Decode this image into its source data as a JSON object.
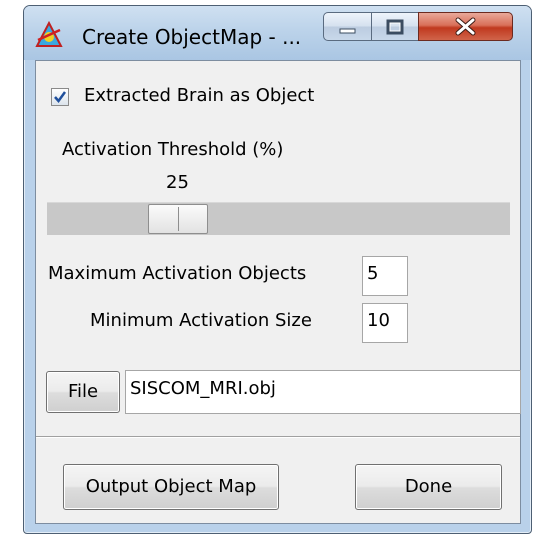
{
  "window": {
    "title": "Create ObjectMap - ...",
    "icon": "app-logo-icon",
    "controls": {
      "minimize": "minimize-icon",
      "maximize": "maximize-icon",
      "close": "close-icon"
    }
  },
  "options": {
    "extract_brain_checked": true,
    "extract_brain_label": "Extracted Brain as Object"
  },
  "threshold": {
    "label": "Activation Threshold (%)",
    "value": "25",
    "slider_fraction": 0.25
  },
  "max_objects": {
    "label": "Maximum Activation Objects",
    "value": "5"
  },
  "min_size": {
    "label": "Minimum Activation Size",
    "value": "10"
  },
  "file": {
    "button_label": "File",
    "path": "SISCOM_MRI.obj"
  },
  "actions": {
    "output_label": "Output Object Map",
    "done_label": "Done"
  }
}
